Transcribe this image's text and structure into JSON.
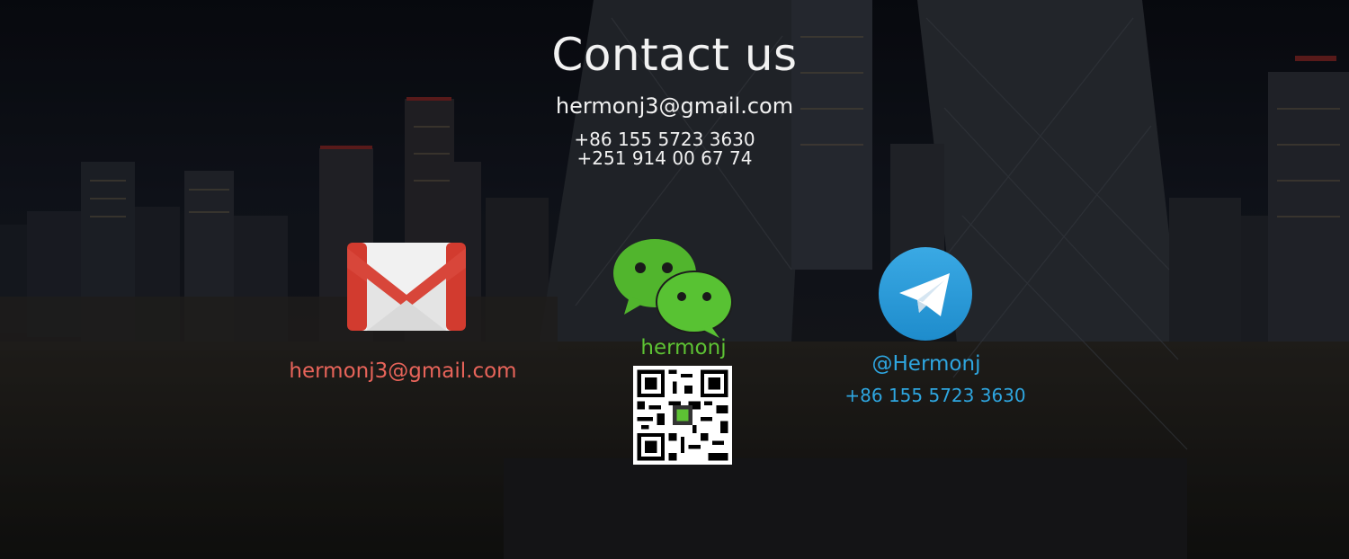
{
  "header": {
    "title": "Contact us",
    "email": "hermonj3@gmail.com",
    "phones": [
      "+86 155 5723 3630",
      "+251 914 00 67 74"
    ]
  },
  "contacts": {
    "gmail": {
      "label": "hermonj3@gmail.com",
      "icon": "gmail-icon",
      "color": "#e8645a"
    },
    "wechat": {
      "label": "hermonj",
      "icon": "wechat-icon",
      "color": "#5dc234",
      "qr_icon": "qr-code-icon"
    },
    "telegram": {
      "handle": "@Hermonj",
      "phone": "+86 155 5723 3630",
      "icon": "telegram-icon",
      "color": "#2ea6e0"
    }
  },
  "background": {
    "scene": "city-skyline-background"
  }
}
